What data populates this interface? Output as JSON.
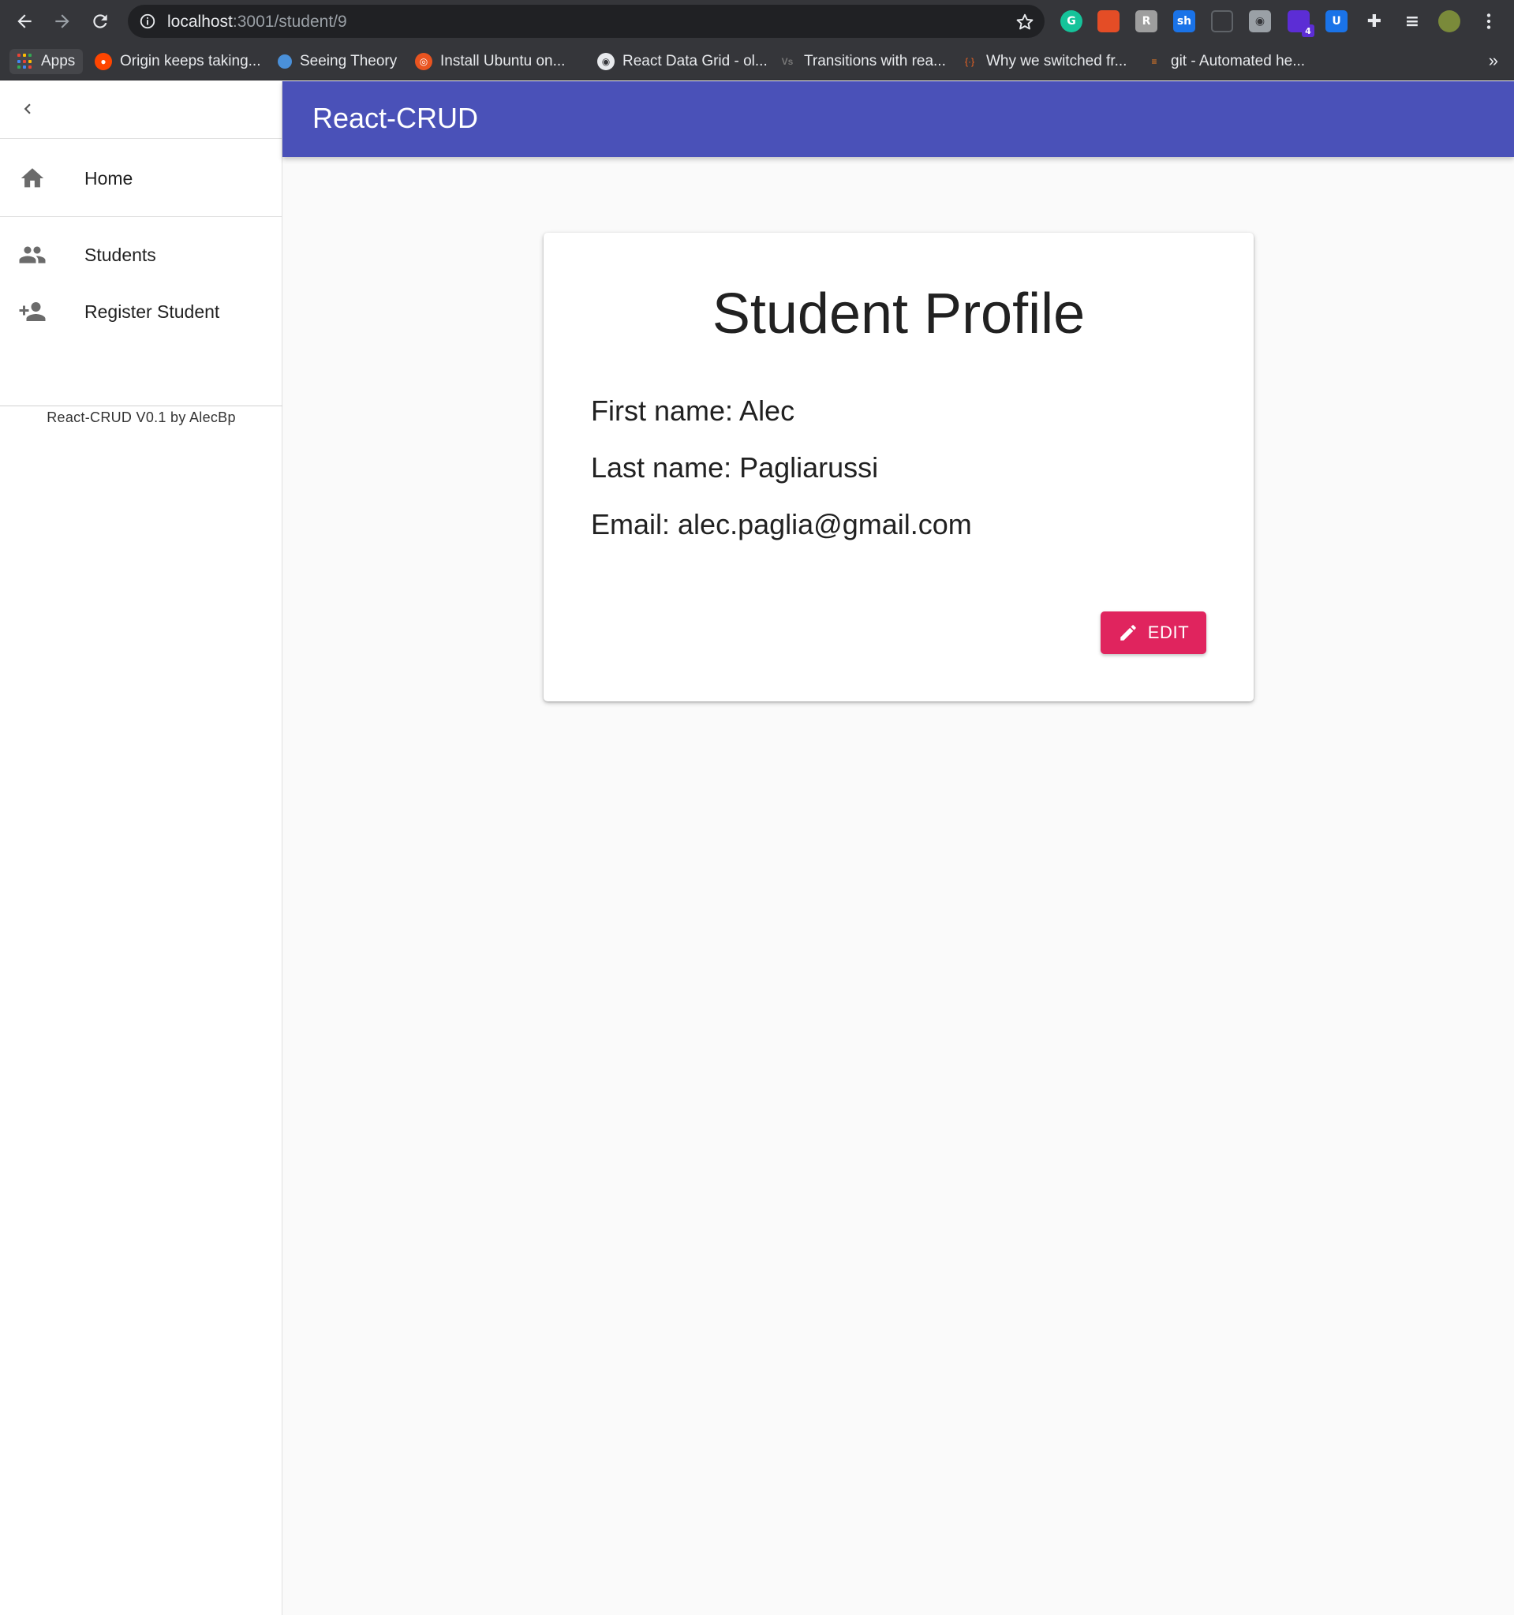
{
  "browser": {
    "url_host": "localhost",
    "url_rest": ":3001/student/9",
    "extensions": [
      {
        "name": "grammarly-icon",
        "letter": "G",
        "color": "#15c39a"
      },
      {
        "name": "extension-red-icon",
        "letter": "",
        "color": "#e44d26"
      },
      {
        "name": "extension-gray-icon",
        "letter": "R",
        "color": "#9e9e9e"
      },
      {
        "name": "extension-sh-icon",
        "letter": "sh",
        "color": "#1a73e8"
      },
      {
        "name": "extension-circle-icon",
        "letter": "",
        "color": "#5f6368"
      },
      {
        "name": "camera-icon",
        "letter": "",
        "color": "#9aa0a6"
      },
      {
        "name": "extension-badge-icon",
        "letter": "",
        "color": "#5c2dd5",
        "badge": "4"
      },
      {
        "name": "extension-shield-icon",
        "letter": "U",
        "color": "#1a73e8"
      },
      {
        "name": "puzzle-icon",
        "letter": "",
        "color": "#e8eaed"
      },
      {
        "name": "reading-list-icon",
        "letter": "",
        "color": "#e8eaed"
      },
      {
        "name": "profile-avatar-icon",
        "letter": "",
        "color": "#7a8a3a"
      }
    ],
    "bookmarks": {
      "apps": "Apps",
      "items": [
        "Origin keeps taking...",
        "Seeing Theory",
        "Install Ubuntu on...",
        "React Data Grid - ol...",
        "Transitions with rea...",
        "Why we switched fr...",
        "git - Automated he..."
      ],
      "more": "»"
    }
  },
  "app": {
    "title": "React-CRUD",
    "accent_color": "#4a51b8",
    "drawer": {
      "items": [
        {
          "label": "Home",
          "icon": "home-icon"
        },
        {
          "label": "Students",
          "icon": "people-icon"
        },
        {
          "label": "Register Student",
          "icon": "person-add-icon"
        }
      ],
      "footer": "React-CRUD V0.1 by AlecBp"
    },
    "profile": {
      "heading": "Student Profile",
      "first_name": "First name: Alec",
      "last_name": "Last name: Pagliarussi",
      "email": "Email: alec.paglia@gmail.com",
      "edit_label": "EDIT",
      "edit_color": "#e0245e"
    }
  }
}
